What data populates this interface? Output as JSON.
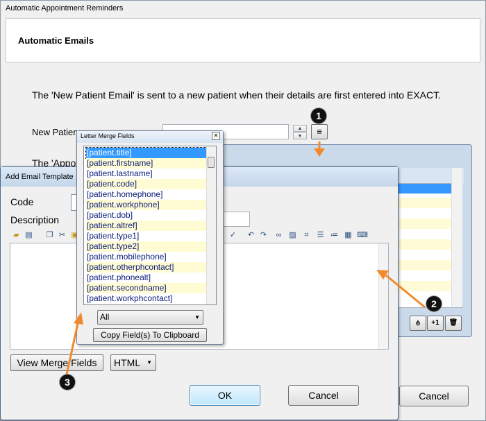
{
  "main_window": {
    "title": "Automatic Appointment Reminders",
    "heading": "Automatic Emails",
    "description": "The 'New Patient Email' is sent to a new patient when their details are first entered into EXACT.",
    "new_patient_label": "New Patient Email",
    "appointment_label": "The 'Appointment",
    "new_patient_value": "",
    "cancel_label": "Cancel"
  },
  "back_dialog": {
    "toolbar": [
      "split-icon",
      "+1",
      "trash-icon"
    ]
  },
  "add_email_template": {
    "title": "Add Email Template",
    "code_label": "Code",
    "description_label": "Description",
    "code_value": "",
    "description_value": "",
    "view_merge_fields_label": "View Merge Fields",
    "format_selected": "HTML",
    "ok_label": "OK",
    "cancel_label": "Cancel"
  },
  "letter_merge_fields": {
    "title": "Letter Merge Fields",
    "items": [
      "[patient.title]",
      "[patient.firstname]",
      "[patient.lastname]",
      "[patient.code]",
      "[patient.homephone]",
      "[patient.workphone]",
      "[patient.dob]",
      "[patient.altref]",
      "[patient.type1]",
      "[patient.type2]",
      "[patient.mobilephone]",
      "[patient.otherphcontact]",
      "[patient.phonealt]",
      "[patient.secondname]",
      "[patient.workphcontact]"
    ],
    "selected_index": 0,
    "filter_selected": "All",
    "copy_label": "Copy Field(s) To Clipboard"
  },
  "callouts": [
    "1",
    "2",
    "3"
  ],
  "colors": {
    "arrow": "#f08a2c",
    "selection": "#3399ff",
    "stripe": "#fffbd2"
  }
}
